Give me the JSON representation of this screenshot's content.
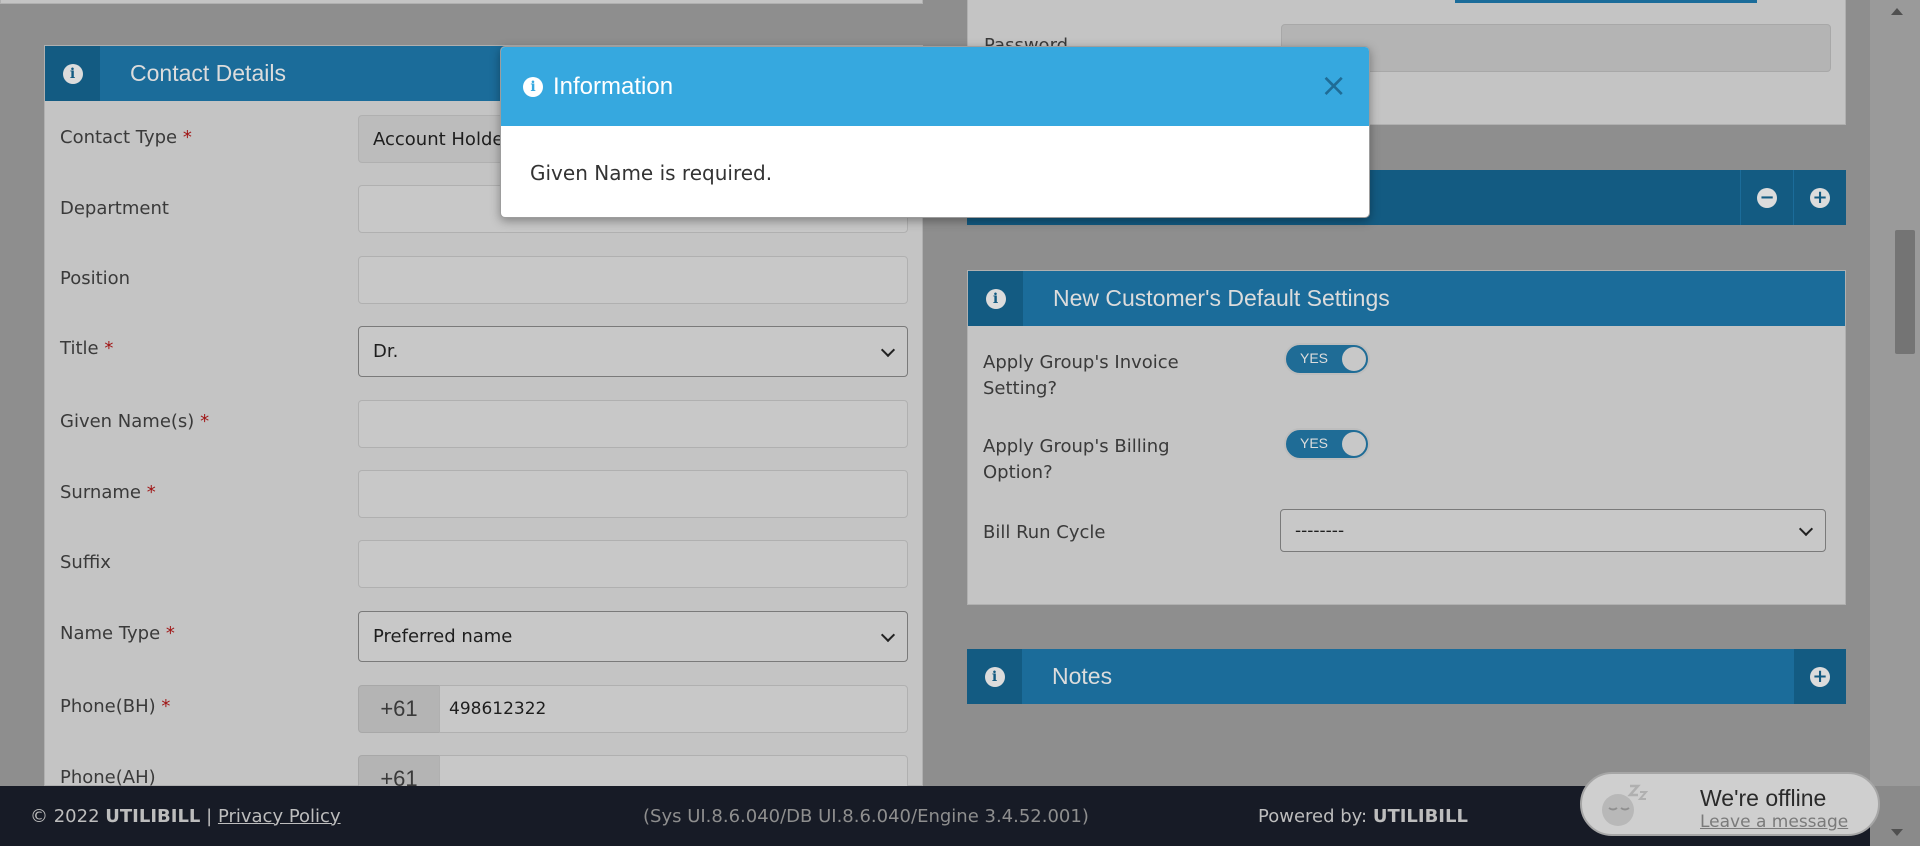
{
  "contact_details": {
    "title": "Contact Details",
    "fields": {
      "contact_type": {
        "label": "Contact Type",
        "value": "Account Holder"
      },
      "department": {
        "label": "Department"
      },
      "position": {
        "label": "Position"
      },
      "title": {
        "label": "Title",
        "value": "Dr."
      },
      "given_names": {
        "label": "Given Name(s)"
      },
      "surname": {
        "label": "Surname"
      },
      "suffix": {
        "label": "Suffix"
      },
      "name_type": {
        "label": "Name Type",
        "value": "Preferred name"
      },
      "phone_bh": {
        "label": "Phone(BH)",
        "prefix": "+61",
        "value": "498612322"
      },
      "phone_ah": {
        "label": "Phone(AH)",
        "prefix": "+61",
        "value": ""
      }
    },
    "required_marker": "*"
  },
  "right_top": {
    "password_label": "Password"
  },
  "default_settings": {
    "title": "New Customer's Default Settings",
    "invoice_setting": {
      "label": "Apply Group's Invoice Setting?",
      "toggle": "YES"
    },
    "billing_option": {
      "label": "Apply Group's Billing Option?",
      "toggle": "YES"
    },
    "bill_run_cycle": {
      "label": "Bill Run Cycle",
      "value": "--------"
    }
  },
  "notes": {
    "title": "Notes"
  },
  "footer": {
    "copyright_prefix": "© 2022",
    "brand": "UTILIBILL",
    "separator": "|",
    "privacy": "Privacy Policy",
    "version": "(Sys UI.8.6.040/DB UI.8.6.040/Engine 3.4.52.001)",
    "powered_label": "Powered by:",
    "powered_brand": "UTILIBILL"
  },
  "chat": {
    "status": "We're offline",
    "action": "Leave a message"
  },
  "modal": {
    "title": "Information",
    "message": "Given Name is required.",
    "close": "×"
  },
  "colors": {
    "modal_header": "#36a8df",
    "panel_header": "#2d8ac2",
    "footer": "#171b26",
    "required": "#c62828"
  }
}
